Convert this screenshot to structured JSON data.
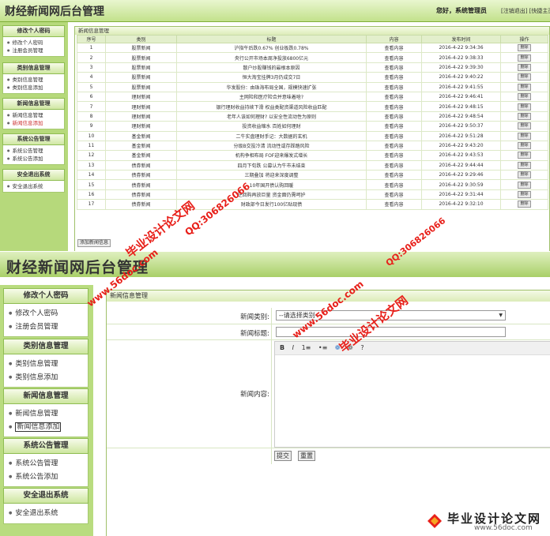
{
  "top": {
    "app_title": "财经新闻网后台管理",
    "greeting": "您好，系统管理员",
    "header_links": "[注销退出] [快捷主页]",
    "sidebar": [
      {
        "head": "修改个人密码",
        "items": [
          "修改个人密码",
          "注册会员管理"
        ]
      },
      {
        "head": "类别信息管理",
        "items": [
          "类别信息管理",
          "类别信息添加"
        ]
      },
      {
        "head": "新闻信息管理",
        "items": [
          "新闻信息管理",
          "新闻信息添加"
        ]
      },
      {
        "head": "系统公告管理",
        "items": [
          "系统公告管理",
          "系统公告添加"
        ]
      },
      {
        "head": "安全退出系统",
        "items": [
          "安全退出系统"
        ]
      }
    ],
    "panel_title": "新闻信息管理",
    "table_headers": [
      "序号",
      "类别",
      "标题",
      "内容",
      "发布时间",
      "操作"
    ],
    "rows": [
      [
        "1",
        "股票新闻",
        "沪指午后跌0.67% 创业板跌0.78%",
        "查看内容",
        "2016-4-22 9:34:36"
      ],
      [
        "2",
        "股票新闻",
        "央行公开市场本周净投放6800亿元",
        "查看内容",
        "2016-4-22 9:38:33"
      ],
      [
        "3",
        "股票新闻",
        "散户炒股赚钱的最根本原因",
        "查看内容",
        "2016-4-22 9:39:30"
      ],
      [
        "4",
        "股票新闻",
        "恒大淘宝挂牌3月仍成交7日",
        "查看内容",
        "2016-4-22 9:40:22"
      ],
      [
        "5",
        "股票新闻",
        "华发股份：由珠海布局全国，规模快速扩张",
        "查看内容",
        "2016-4-22 9:41:55"
      ],
      [
        "6",
        "理财新闻",
        "主网险和医疗险合并意味着啥?",
        "查看内容",
        "2016-4-22 9:46:41"
      ],
      [
        "7",
        "理财新闻",
        "银行理财收益持续下滑 权益类配资渠道风险收益匹配",
        "查看内容",
        "2016-4-22 9:48:15"
      ],
      [
        "8",
        "理财新闻",
        "老年人该如何理财? 以安全性流动性为原则",
        "查看内容",
        "2016-4-22 9:48:54"
      ],
      [
        "9",
        "理财新闻",
        "投资收益缩水 百姓如何理财",
        "查看内容",
        "2016-4-22 9:50:37"
      ],
      [
        "10",
        "基金新闻",
        "二牛实盘理财手记：大数据的玄机",
        "查看内容",
        "2016-4-22 9:51:28"
      ],
      [
        "11",
        "基金新闻",
        "分级B交投冷清 流动性或存踩踏风险",
        "查看内容",
        "2016-4-22 9:43:20"
      ],
      [
        "12",
        "基金新闻",
        "机构争相布局 FOF迎来爆发式增长",
        "查看内容",
        "2016-4-22 9:43:53"
      ],
      [
        "13",
        "债券新闻",
        "四月下旬跌 公募认为牛市未结束",
        "查看内容",
        "2016-4-22 9:44:44"
      ],
      [
        "14",
        "债券新闻",
        "三期叠加 将迎来深度调整",
        "查看内容",
        "2016-4-22 9:29:46"
      ],
      [
        "15",
        "债券新闻",
        "10年国开债认购回暖",
        "查看内容",
        "2016-4-22 9:30:59"
      ],
      [
        "16",
        "债券新闻",
        "逆回购再放巨量 资金面仍需呵护",
        "查看内容",
        "2016-4-22 9:31:44"
      ],
      [
        "17",
        "债券新闻",
        "财政部今日发行100亿贴现债",
        "查看内容",
        "2016-4-22 9:32:10"
      ]
    ],
    "delete_label": "删除",
    "add_button": "添加新闻信息"
  },
  "bottom": {
    "app_title": "财经新闻网后台管理",
    "sidebar": [
      {
        "head": "修改个人密码",
        "items": [
          "修改个人密码",
          "注册会员管理"
        ]
      },
      {
        "head": "类别信息管理",
        "items": [
          "类别信息管理",
          "类别信息添加"
        ]
      },
      {
        "head": "新闻信息管理",
        "items": [
          "新闻信息管理",
          "新闻信息添加"
        ]
      },
      {
        "head": "系统公告管理",
        "items": [
          "系统公告管理",
          "系统公告添加"
        ]
      },
      {
        "head": "安全退出系统",
        "items": [
          "安全退出系统"
        ]
      }
    ],
    "panel_title": "新闻信息管理",
    "form": {
      "category_label": "新闻类别:",
      "category_value": "--请选择类别--",
      "title_label": "新闻标题:",
      "content_label": "新闻内容:",
      "submit": "提交",
      "reset": "重置"
    },
    "editor_toolbar": [
      "B",
      "I",
      "1≡",
      "•≡",
      "❁",
      "❁",
      "?"
    ]
  },
  "watermark": {
    "cn": "毕业设计论文网",
    "url": "www.56doc.com",
    "qq": "QQ:306826066"
  },
  "footer": {
    "brand": "毕业设计论文网",
    "url": "www.56doc.com"
  }
}
